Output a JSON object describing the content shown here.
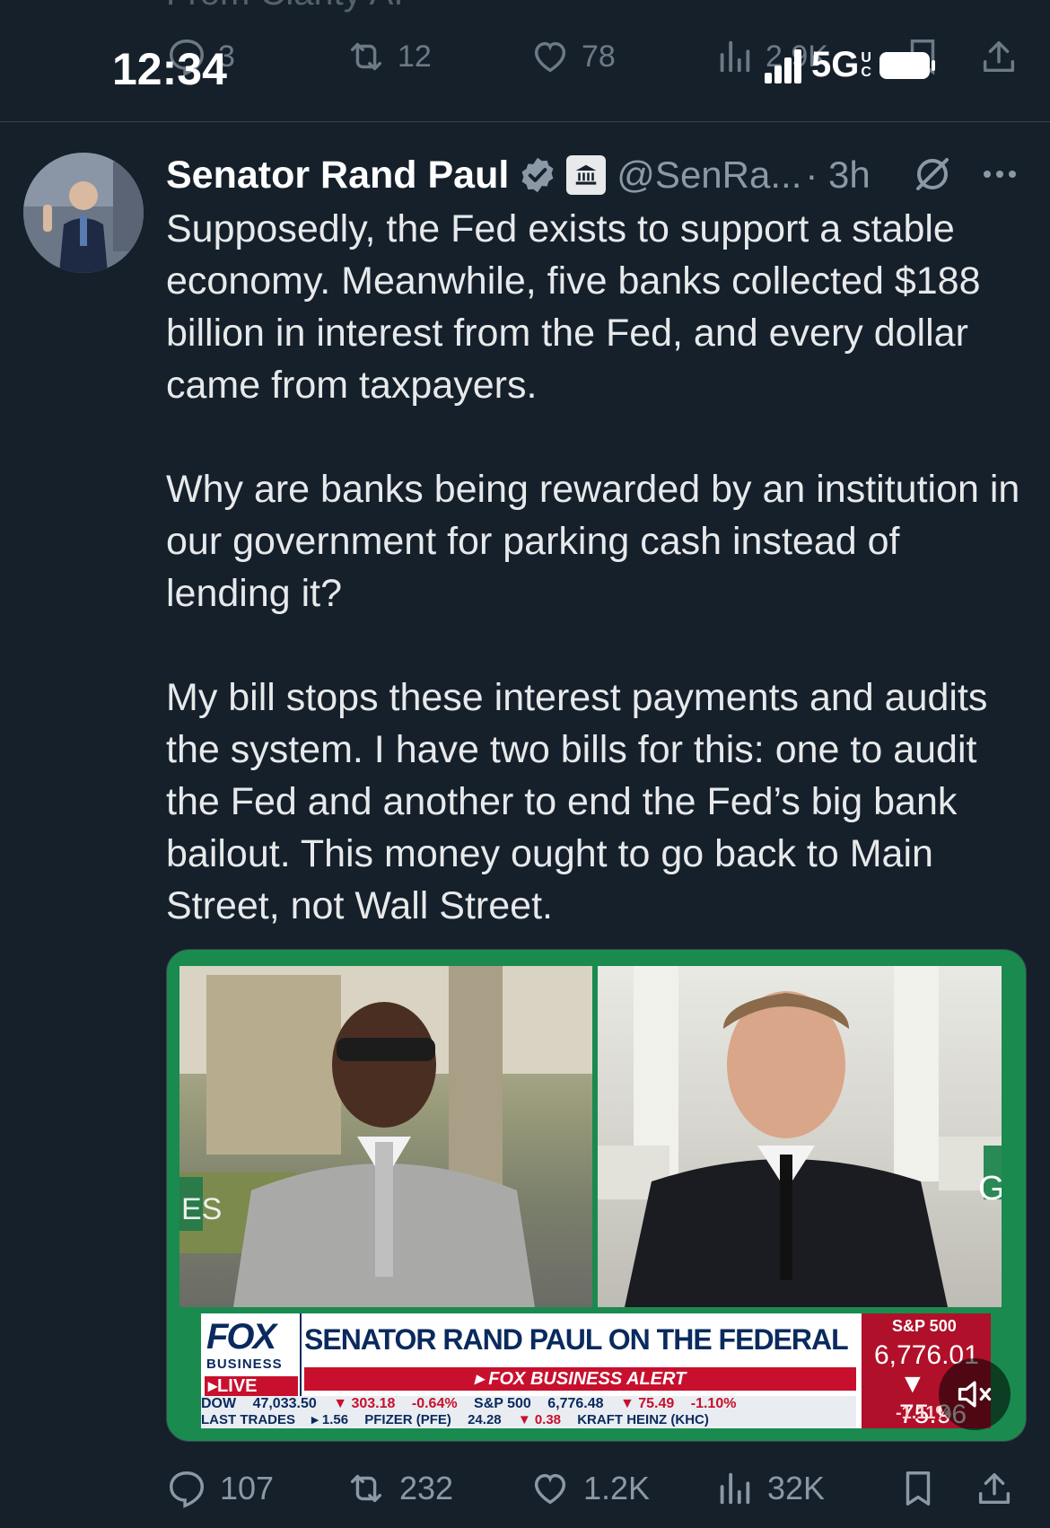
{
  "status_bar": {
    "time": "12:34",
    "network": "5G",
    "network_sub_top": "U",
    "network_sub_bottom": "C"
  },
  "ghost": {
    "top_text": "From Clarity AI",
    "reply_count": "3",
    "repost_count": "12",
    "like_count": "78",
    "view_count": "2.9K"
  },
  "tweet": {
    "author_name": "Senator Rand Paul",
    "handle": "@SenRa...",
    "time": "· 3h",
    "paragraphs": [
      "Supposedly, the Fed exists to support a stable economy. Meanwhile, five banks collected $188 billion in interest from the Fed, and every dollar came from taxpayers.",
      "Why are banks being rewarded by an institution in our government for parking cash instead of lending it?",
      "My bill stops these interest payments and audits the system. I have two bills for this: one to audit the Fed and another to end the Fed’s big bank bailout. This money ought to go back to Main Street, not Wall Street."
    ]
  },
  "media": {
    "fox_word": "FOX",
    "fox_business": "BUSINESS",
    "live_label": "▸LIVE",
    "headline": "SENATOR RAND PAUL ON THE FEDERAL RESERVE",
    "alert": "▸ FOX BUSINESS ALERT",
    "row1": {
      "dow_label": "DOW",
      "dow_value": "47,033.50",
      "dow_change": "▼ 303.18",
      "dow_pct": "-0.64%",
      "sp_label": "S&P 500",
      "sp_value": "6,776.48",
      "sp_change": "▼ 75.49",
      "sp_pct": "-1.10%"
    },
    "row2": {
      "last_trades": "LAST TRADES",
      "arrow": "▸ 1.56",
      "pfizer": "PFIZER (PFE)",
      "pfizer_price": "24.28",
      "pfizer_change": "▼ 0.38",
      "kraft": "KRAFT HEINZ (KHC)"
    },
    "sp_box": {
      "label": "S&P 500",
      "value": "6,776.01",
      "change": "▼ 75.96",
      "pct": "-1.11%"
    },
    "overlay_left": "ES",
    "overlay_right": "G"
  },
  "actions": {
    "replies": "107",
    "reposts": "232",
    "likes": "1.2K",
    "views": "32K"
  },
  "colors": {
    "background": "#15202b",
    "text": "#e7e9ea",
    "muted": "#8b98a5",
    "verified": "#1d9bf0",
    "fox_red": "#c8102e",
    "fox_navy": "#0a2a5e"
  },
  "icons": [
    "reply-icon",
    "repost-icon",
    "like-icon",
    "views-icon",
    "bookmark-icon",
    "share-icon",
    "verified-icon",
    "government-badge-icon",
    "grok-icon",
    "more-icon",
    "mute-icon",
    "signal-icon",
    "battery-icon"
  ]
}
